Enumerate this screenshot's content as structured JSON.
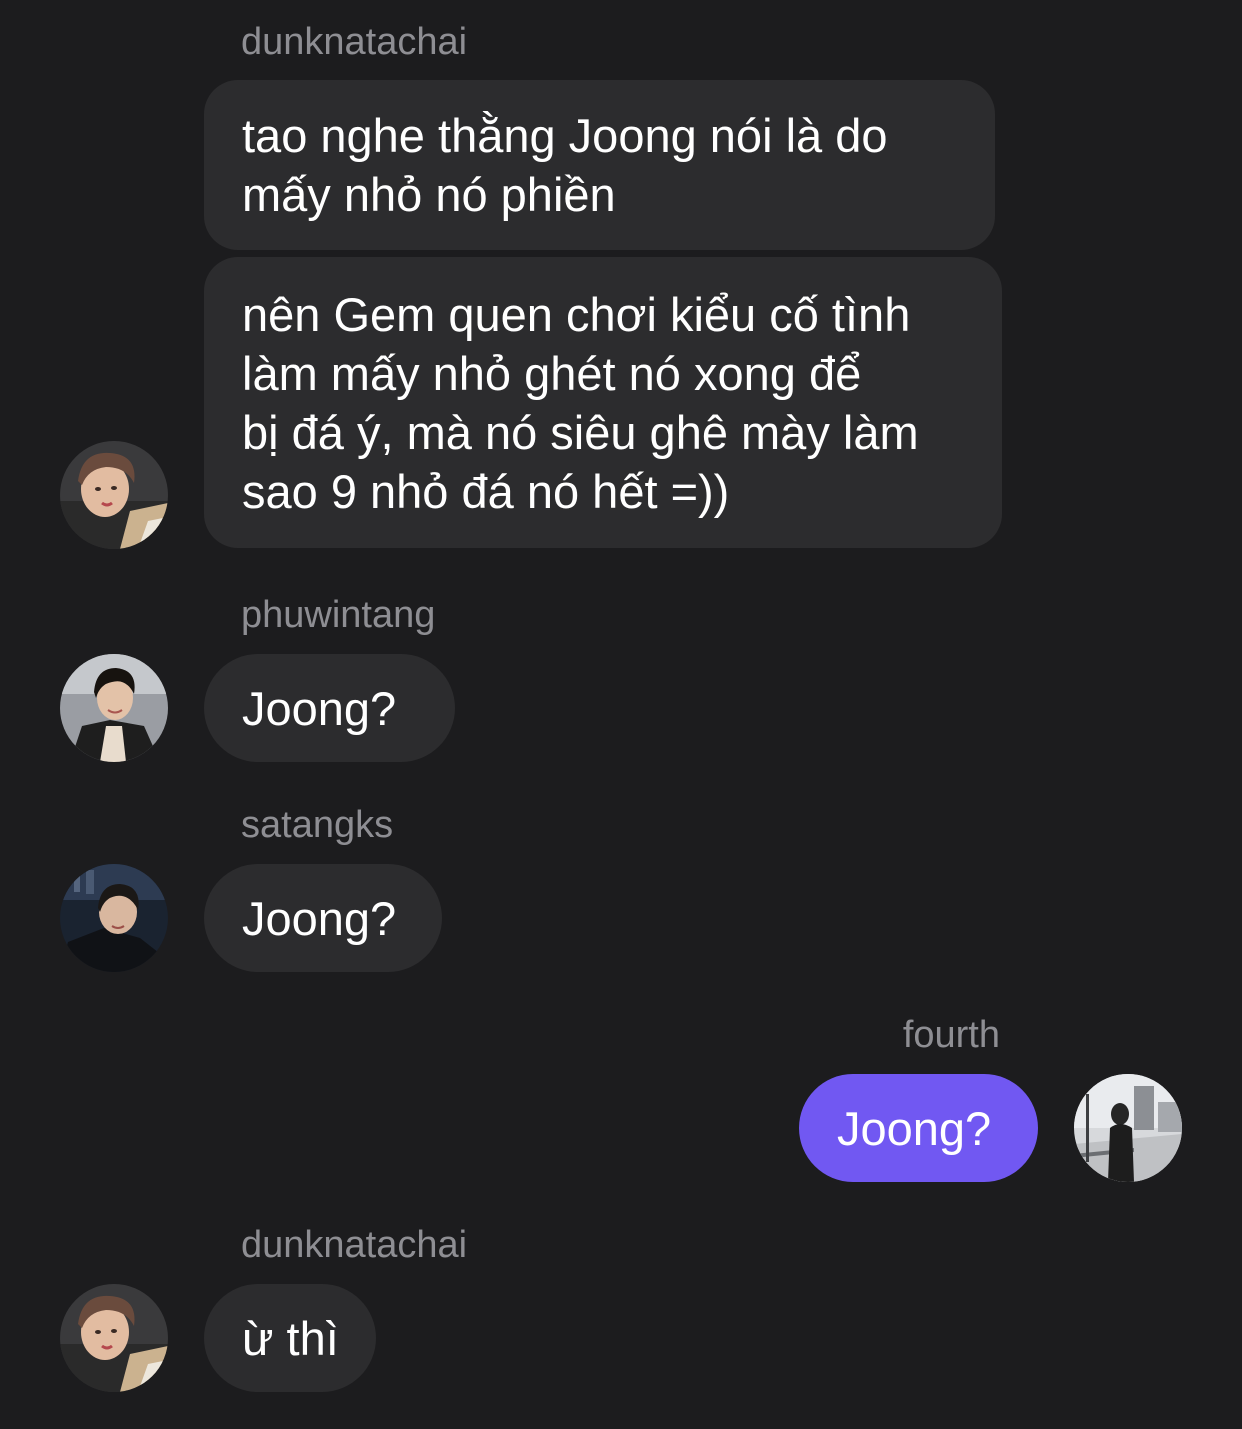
{
  "messages": [
    {
      "sender": "dunknatachai",
      "lines": [
        "tao nghe thằng Joong nói là do",
        "mấy nhỏ nó phiền"
      ]
    },
    {
      "sender": "",
      "lines": [
        "nên Gem quen chơi kiểu cố tình",
        "làm mấy nhỏ ghét nó xong để",
        "bị đá ý, mà nó siêu ghê mày làm",
        "sao 9 nhỏ đá nó hết =))"
      ]
    },
    {
      "sender": "phuwintang",
      "lines": [
        "Joong?"
      ]
    },
    {
      "sender": "satangks",
      "lines": [
        "Joong?"
      ]
    },
    {
      "sender": "fourth",
      "lines": [
        "Joong?"
      ]
    },
    {
      "sender": "dunknatachai",
      "lines": [
        "ừ thì"
      ]
    }
  ],
  "avatars": {
    "dunknatachai": "avatar-dunknatachai-photo",
    "phuwintang": "avatar-phuwintang-photo",
    "satangks": "avatar-satangks-photo",
    "fourth": "avatar-fourth-photo"
  },
  "colors": {
    "background": "#1c1c1e",
    "incoming_bubble": "#2c2c2e",
    "outgoing_bubble": "#7158f2",
    "sender_name": "#8e8e93",
    "message_text": "#ffffff"
  }
}
